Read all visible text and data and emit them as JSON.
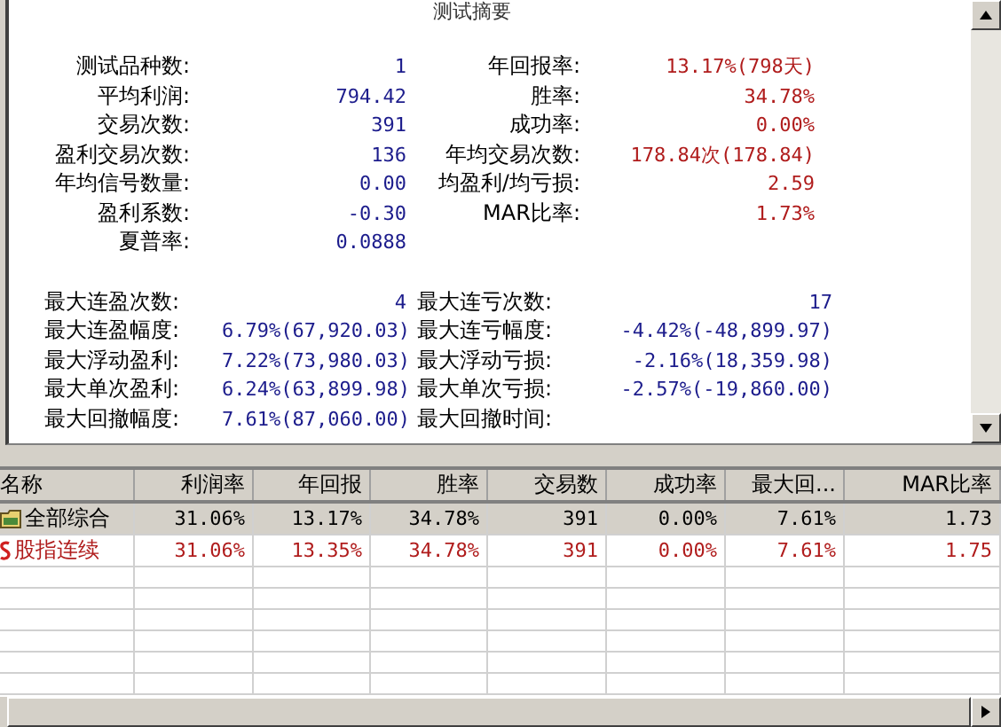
{
  "summary": {
    "title": "测试摘要",
    "top_left": [
      {
        "label": "测试品种数:",
        "value": "1",
        "color": "#1c1c8c"
      },
      {
        "label": "平均利润:",
        "value": "794.42",
        "color": "#1c1c8c"
      },
      {
        "label": "交易次数:",
        "value": "391",
        "color": "#1c1c8c"
      },
      {
        "label": "盈利交易次数:",
        "value": "136",
        "color": "#1c1c8c"
      },
      {
        "label": "年均信号数量:",
        "value": "0.00",
        "color": "#1c1c8c"
      },
      {
        "label": "盈利系数:",
        "value": "-0.30",
        "color": "#1c1c8c"
      },
      {
        "label": "夏普率:",
        "value": "0.0888",
        "color": "#1c1c8c"
      }
    ],
    "top_right": [
      {
        "label": "年回报率:",
        "value": "13.17%(798天)",
        "color": "#b01c1c"
      },
      {
        "label": "胜率:",
        "value": "34.78%",
        "color": "#b01c1c"
      },
      {
        "label": "成功率:",
        "value": "0.00%",
        "color": "#b01c1c"
      },
      {
        "label": "年均交易次数:",
        "value": "178.84次(178.84)",
        "color": "#b01c1c"
      },
      {
        "label": "均盈利/均亏损:",
        "value": "2.59",
        "color": "#b01c1c"
      },
      {
        "label": "MAR比率:",
        "value": "1.73%",
        "color": "#b01c1c"
      }
    ],
    "bottom_left": [
      {
        "label": "最大连盈次数:",
        "value": "4",
        "color": "#1c1c8c"
      },
      {
        "label": "最大连盈幅度:",
        "value": "6.79%(67,920.03)",
        "color": "#1c1c8c"
      },
      {
        "label": "最大浮动盈利:",
        "value": "7.22%(73,980.03)",
        "color": "#1c1c8c"
      },
      {
        "label": "最大单次盈利:",
        "value": "6.24%(63,899.98)",
        "color": "#1c1c8c"
      },
      {
        "label": "最大回撤幅度:",
        "value": "7.61%(87,060.00)",
        "color": "#1c1c8c"
      }
    ],
    "bottom_right": [
      {
        "label": "最大连亏次数:",
        "value": "17",
        "color": "#1c1c8c"
      },
      {
        "label": "最大连亏幅度:",
        "value": "-4.42%(-48,899.97)",
        "color": "#1c1c8c"
      },
      {
        "label": "最大浮动亏损:",
        "value": "-2.16%(18,359.98)",
        "color": "#1c1c8c"
      },
      {
        "label": "最大单次亏损:",
        "value": "-2.57%(-19,860.00)",
        "color": "#1c1c8c"
      },
      {
        "label": "最大回撤时间:"
      }
    ]
  },
  "table": {
    "columns": [
      "名称",
      "利润率",
      "年回报",
      "胜率",
      "交易数",
      "成功率",
      "最大回...",
      "MAR比率"
    ],
    "rows": [
      {
        "kind": "group",
        "selected": true,
        "cells": [
          "全部综合",
          "31.06%",
          "13.17%",
          "34.78%",
          "391",
          "0.00%",
          "7.61%",
          "1.73"
        ]
      },
      {
        "kind": "item",
        "selected": false,
        "cells": [
          "股指连续",
          "31.06%",
          "13.35%",
          "34.78%",
          "391",
          "0.00%",
          "7.61%",
          "1.75"
        ]
      }
    ]
  }
}
